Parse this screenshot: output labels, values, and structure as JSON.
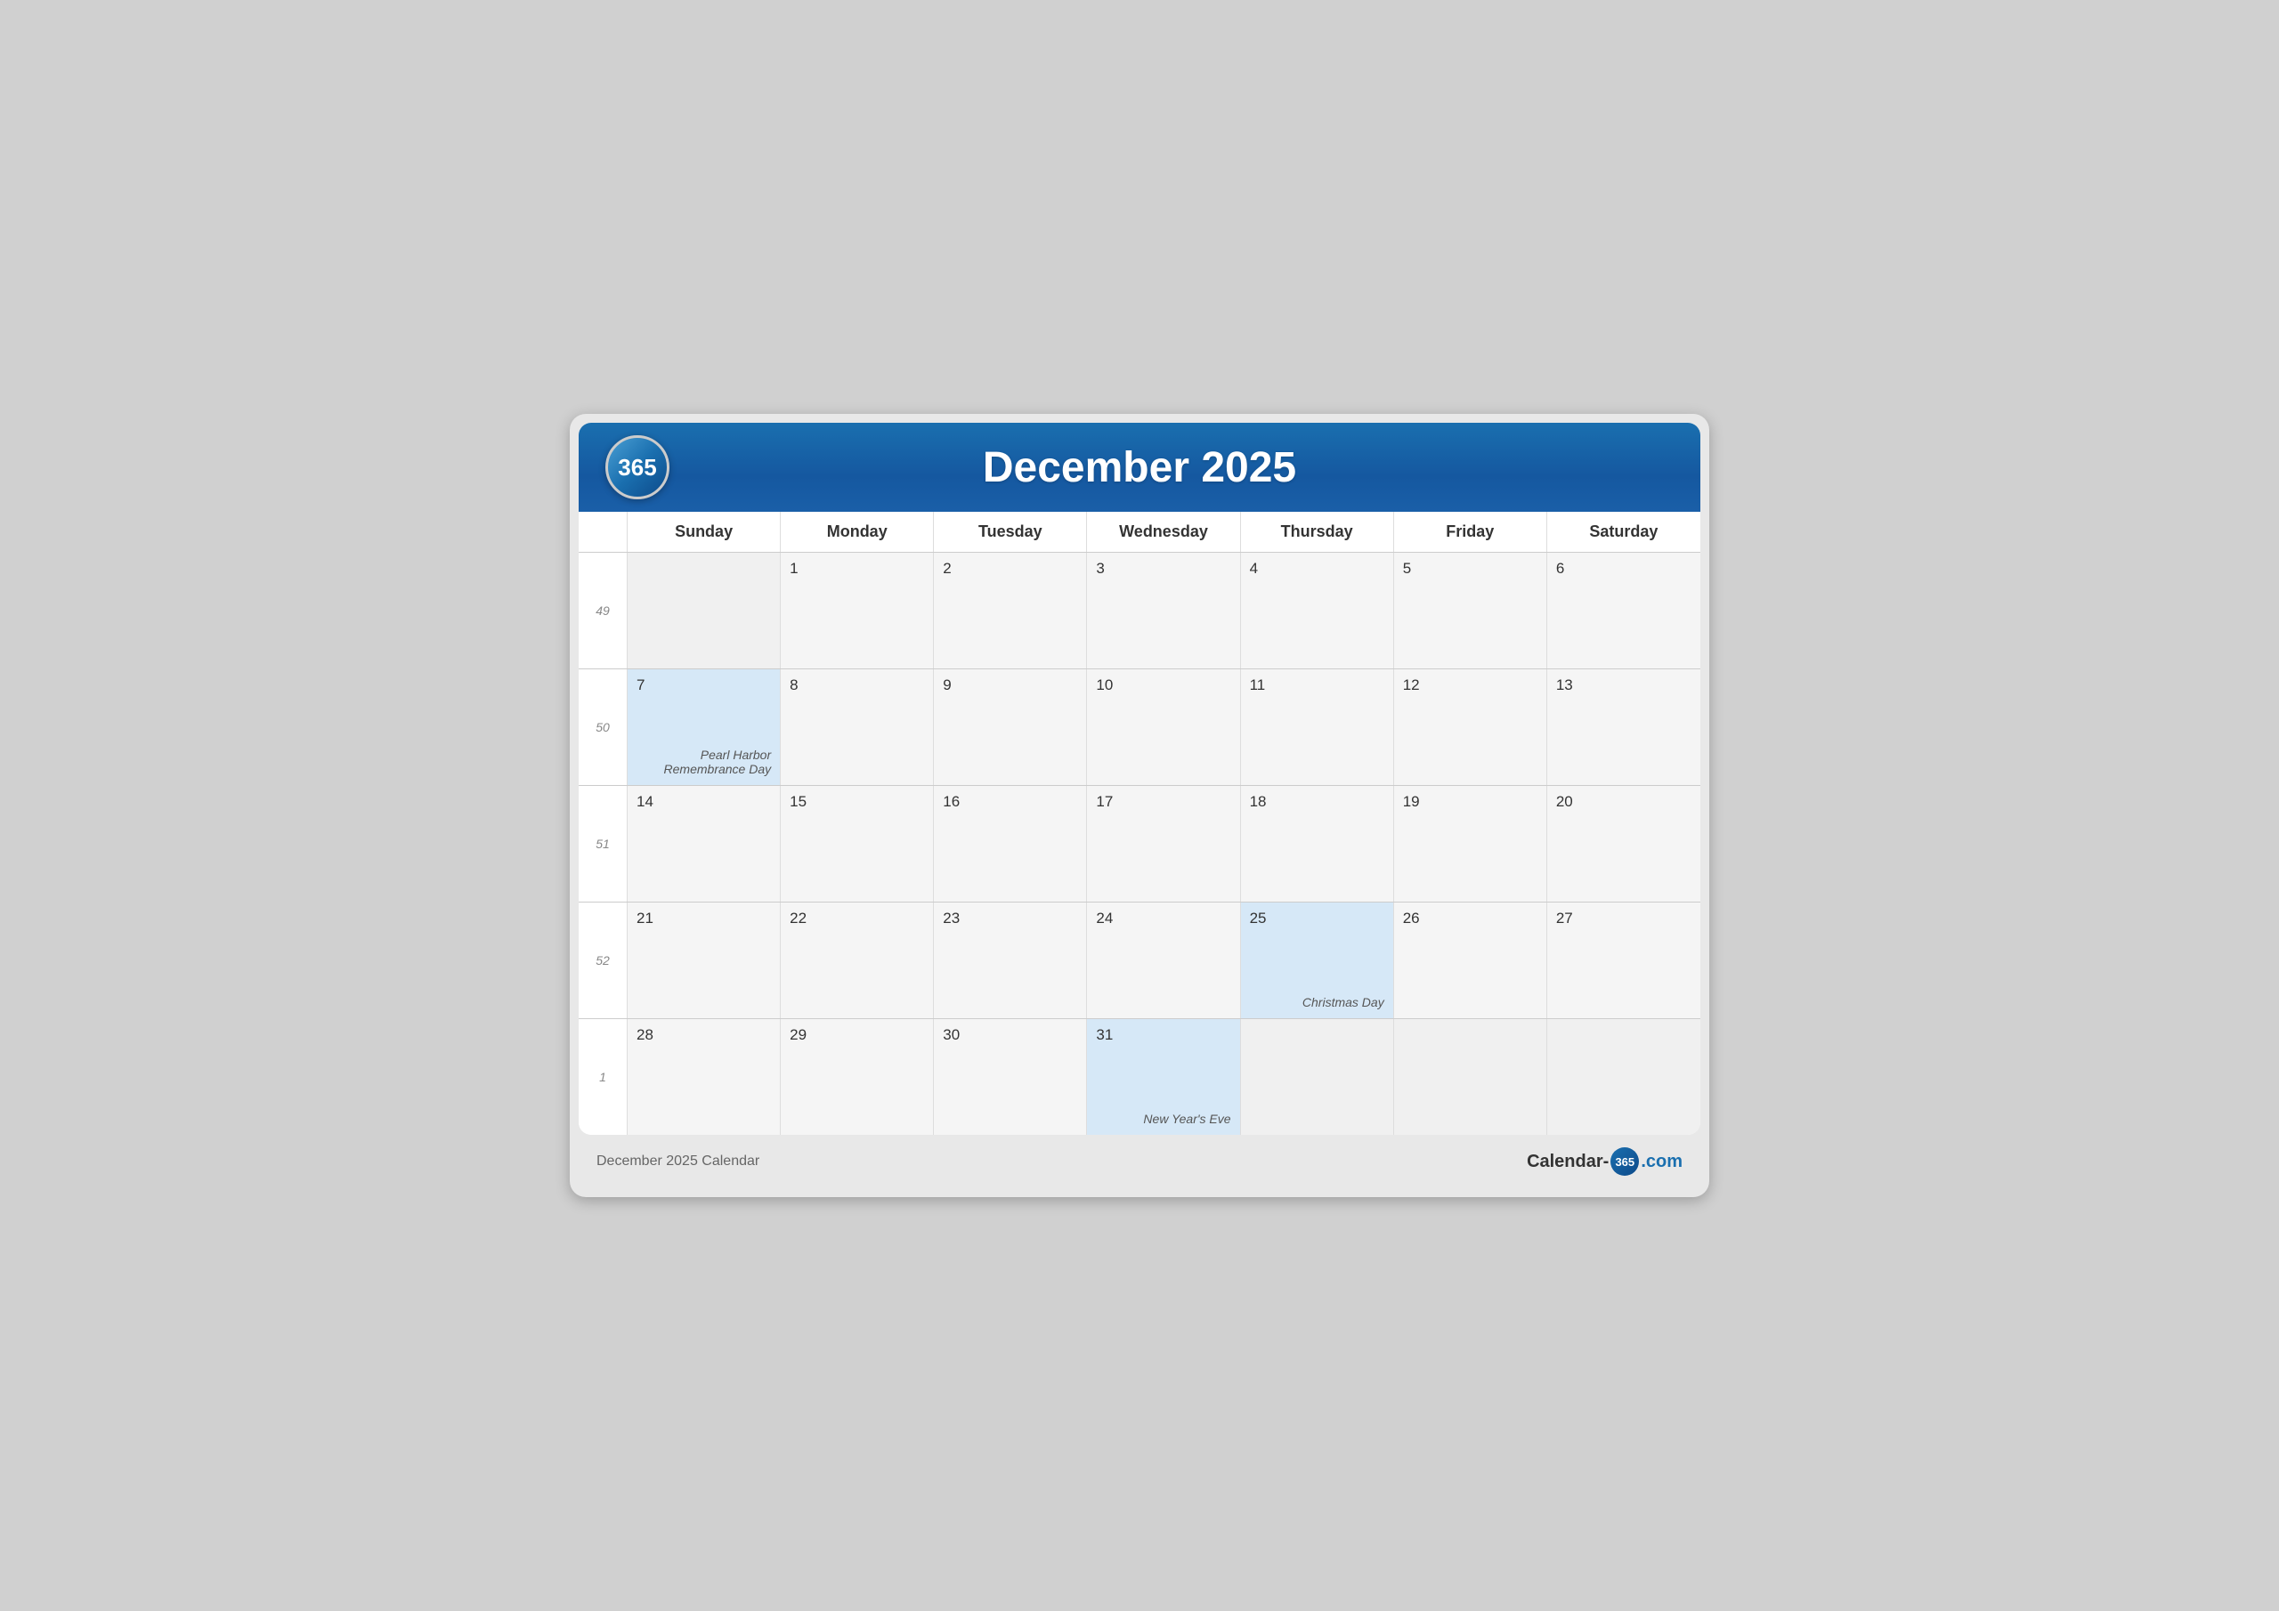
{
  "header": {
    "logo": "365",
    "title": "December 2025"
  },
  "days_of_week": [
    "Sunday",
    "Monday",
    "Tuesday",
    "Wednesday",
    "Thursday",
    "Friday",
    "Saturday"
  ],
  "rows": [
    {
      "week": "49",
      "days": [
        {
          "num": "",
          "style": "empty"
        },
        {
          "num": "1",
          "style": "normal"
        },
        {
          "num": "2",
          "style": "normal"
        },
        {
          "num": "3",
          "style": "normal"
        },
        {
          "num": "4",
          "style": "normal"
        },
        {
          "num": "5",
          "style": "normal"
        },
        {
          "num": "6",
          "style": "normal"
        }
      ]
    },
    {
      "week": "50",
      "days": [
        {
          "num": "7",
          "style": "highlight",
          "event": "Pearl Harbor Remembrance Day"
        },
        {
          "num": "8",
          "style": "normal"
        },
        {
          "num": "9",
          "style": "normal"
        },
        {
          "num": "10",
          "style": "normal"
        },
        {
          "num": "11",
          "style": "normal"
        },
        {
          "num": "12",
          "style": "normal"
        },
        {
          "num": "13",
          "style": "normal"
        }
      ]
    },
    {
      "week": "51",
      "days": [
        {
          "num": "14",
          "style": "normal"
        },
        {
          "num": "15",
          "style": "normal"
        },
        {
          "num": "16",
          "style": "normal"
        },
        {
          "num": "17",
          "style": "normal"
        },
        {
          "num": "18",
          "style": "normal"
        },
        {
          "num": "19",
          "style": "normal"
        },
        {
          "num": "20",
          "style": "normal"
        }
      ]
    },
    {
      "week": "52",
      "days": [
        {
          "num": "21",
          "style": "normal"
        },
        {
          "num": "22",
          "style": "normal"
        },
        {
          "num": "23",
          "style": "normal"
        },
        {
          "num": "24",
          "style": "normal"
        },
        {
          "num": "25",
          "style": "highlight",
          "event": "Christmas Day"
        },
        {
          "num": "26",
          "style": "normal"
        },
        {
          "num": "27",
          "style": "normal"
        }
      ]
    },
    {
      "week": "1",
      "days": [
        {
          "num": "28",
          "style": "normal"
        },
        {
          "num": "29",
          "style": "normal"
        },
        {
          "num": "30",
          "style": "normal"
        },
        {
          "num": "31",
          "style": "highlight",
          "event": "New Year's Eve"
        },
        {
          "num": "",
          "style": "empty"
        },
        {
          "num": "",
          "style": "empty"
        },
        {
          "num": "",
          "style": "empty"
        }
      ]
    }
  ],
  "footer": {
    "label": "December 2025 Calendar",
    "brand_prefix": "Calendar-",
    "brand_num": "365",
    "brand_suffix": ".com"
  }
}
